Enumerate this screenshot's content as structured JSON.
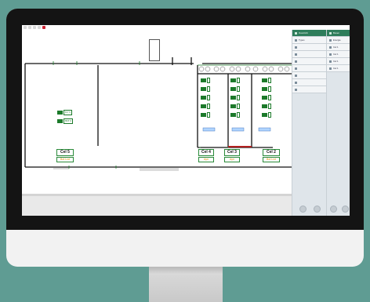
{
  "floor_plan": {
    "floating_box": [
      "",
      "",
      "",
      ""
    ],
    "cells": [
      {
        "name": "Cel 5",
        "status": "Bot Lvd"
      },
      {
        "name": "Cel 4",
        "status": "Ayn"
      },
      {
        "name": "Cel 3",
        "status": "Ayn"
      },
      {
        "name": "Cel 2",
        "status": "Bot Lvd"
      }
    ],
    "left_sensors": [
      {
        "value": "8,6 °C"
      },
      {
        "value": "88,8 %"
      }
    ],
    "col_sensors": [
      [
        "",
        "",
        "",
        "",
        "",
        ""
      ],
      [
        "",
        "",
        "",
        "",
        "",
        ""
      ],
      [
        "",
        "",
        "",
        "",
        "",
        ""
      ]
    ]
  },
  "sidebar_primary": {
    "items": [
      {
        "label": "Overzicht",
        "active": true
      },
      {
        "label": "Types"
      },
      {
        "label": ""
      },
      {
        "label": ""
      },
      {
        "label": ""
      },
      {
        "label": ""
      },
      {
        "label": ""
      },
      {
        "label": ""
      },
      {
        "label": ""
      }
    ]
  },
  "sidebar_secondary": {
    "items": [
      {
        "label": "Boven",
        "active": true
      },
      {
        "label": "Energie"
      },
      {
        "label": "Cel 1"
      },
      {
        "label": "Cel 1"
      },
      {
        "label": "Cel 1"
      },
      {
        "label": "Cel 1"
      }
    ]
  },
  "colors": {
    "accent": "#2e7d5b",
    "sensor_green": "#1c7a2a",
    "status_orange": "#e08a00"
  }
}
